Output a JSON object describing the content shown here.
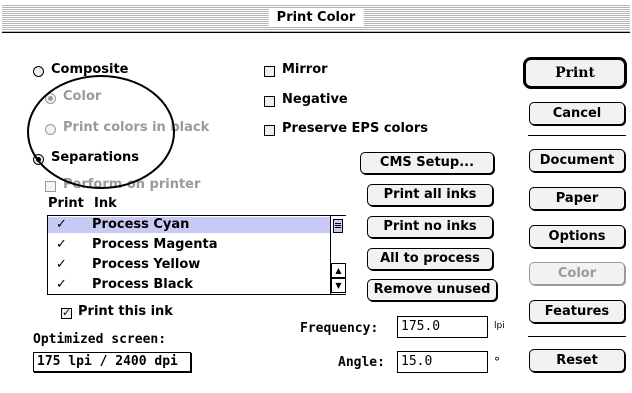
{
  "window": {
    "title": "Print Color"
  },
  "output_mode": {
    "composite_label": "Composite",
    "color_label": "Color",
    "print_colors_black_label": "Print colors in black",
    "separations_label": "Separations",
    "perform_on_printer_label": "Perform on printer",
    "selected": "Separations"
  },
  "options": {
    "mirror_label": "Mirror",
    "negative_label": "Negative",
    "preserve_eps_label": "Preserve EPS colors"
  },
  "ink_list": {
    "header_print": "Print",
    "header_ink": "Ink",
    "check_glyph": "✓",
    "items": [
      {
        "checked": true,
        "name": "Process Cyan",
        "selected": true
      },
      {
        "checked": true,
        "name": "Process Magenta",
        "selected": false
      },
      {
        "checked": true,
        "name": "Process Yellow",
        "selected": false
      },
      {
        "checked": true,
        "name": "Process Black",
        "selected": false
      }
    ]
  },
  "ink_buttons": {
    "cms_setup": "CMS Setup...",
    "print_all": "Print all inks",
    "print_no": "Print no inks",
    "all_to_process": "All to process",
    "remove_unused": "Remove unused"
  },
  "print_this_ink": {
    "label": "Print this ink",
    "checked": true
  },
  "optimized_screen": {
    "label": "Optimized screen:",
    "value": "175 lpi / 2400 dpi"
  },
  "frequency": {
    "label": "Frequency:",
    "value": "175.0",
    "unit": "lpi"
  },
  "angle": {
    "label": "Angle:",
    "value": "15.0",
    "unit": "°"
  },
  "side_buttons": {
    "print": "Print",
    "cancel": "Cancel",
    "document": "Document",
    "paper": "Paper",
    "options": "Options",
    "color": "Color",
    "features": "Features",
    "reset": "Reset"
  },
  "colors": {
    "selection": "#c9c9f5",
    "disabled_text": "#9a9a9a"
  }
}
